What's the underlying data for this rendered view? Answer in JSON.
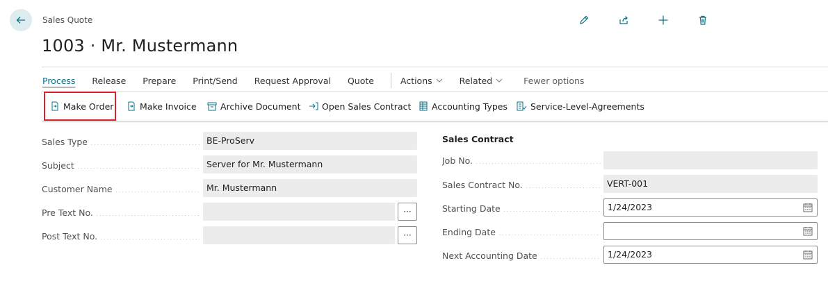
{
  "header": {
    "caption": "Sales Quote",
    "title": "1003 · Mr. Mustermann",
    "top_actions": [
      "pencil-icon",
      "share-icon",
      "plus-icon",
      "trash-icon"
    ]
  },
  "menu": {
    "items": [
      "Process",
      "Release",
      "Prepare",
      "Print/Send",
      "Request Approval",
      "Quote"
    ],
    "actions": "Actions",
    "related": "Related",
    "fewer": "Fewer options"
  },
  "actions": {
    "make_order": "Make Order",
    "make_invoice": "Make Invoice",
    "archive_document": "Archive Document",
    "open_sales_contract": "Open Sales Contract",
    "accounting_types": "Accounting Types",
    "sla": "Service-Level-Agreements"
  },
  "left_fields": [
    {
      "label": "Sales Type",
      "value": "BE-ProServ"
    },
    {
      "label": "Subject",
      "value": "Server for Mr. Mustermann"
    },
    {
      "label": "Customer Name",
      "value": "Mr. Mustermann"
    },
    {
      "label": "Pre Text No.",
      "value": ""
    },
    {
      "label": "Post Text No.",
      "value": ""
    }
  ],
  "lookup_label": "···",
  "sales_contract": {
    "title": "Sales Contract",
    "fields": [
      {
        "label": "Job No.",
        "value": ""
      },
      {
        "label": "Sales Contract No.",
        "value": "VERT-001"
      },
      {
        "label": "Starting Date",
        "value": "1/24/2023"
      },
      {
        "label": "Ending Date",
        "value": ""
      },
      {
        "label": "Next Accounting Date",
        "value": "1/24/2023"
      }
    ]
  },
  "colors": {
    "accent": "#0b7089",
    "highlight": "#d9242c",
    "field_bg": "#ececec"
  }
}
